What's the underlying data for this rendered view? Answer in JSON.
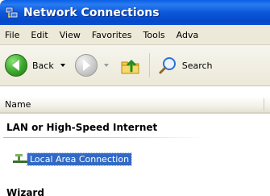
{
  "window": {
    "title": "Network Connections"
  },
  "menu": [
    "File",
    "Edit",
    "View",
    "Favorites",
    "Tools",
    "Adva"
  ],
  "toolbar": {
    "back_label": "Back",
    "search_label": "Search"
  },
  "list": {
    "column_name": "Name",
    "groups": [
      {
        "heading": "LAN or High-Speed Internet",
        "items": [
          {
            "label": "Local Area Connection",
            "selected": true
          }
        ]
      },
      {
        "heading": "Wizard"
      }
    ]
  },
  "colors": {
    "titlebar": "#0a5fe6",
    "selection": "#316ac5",
    "chrome": "#ece9d8"
  }
}
